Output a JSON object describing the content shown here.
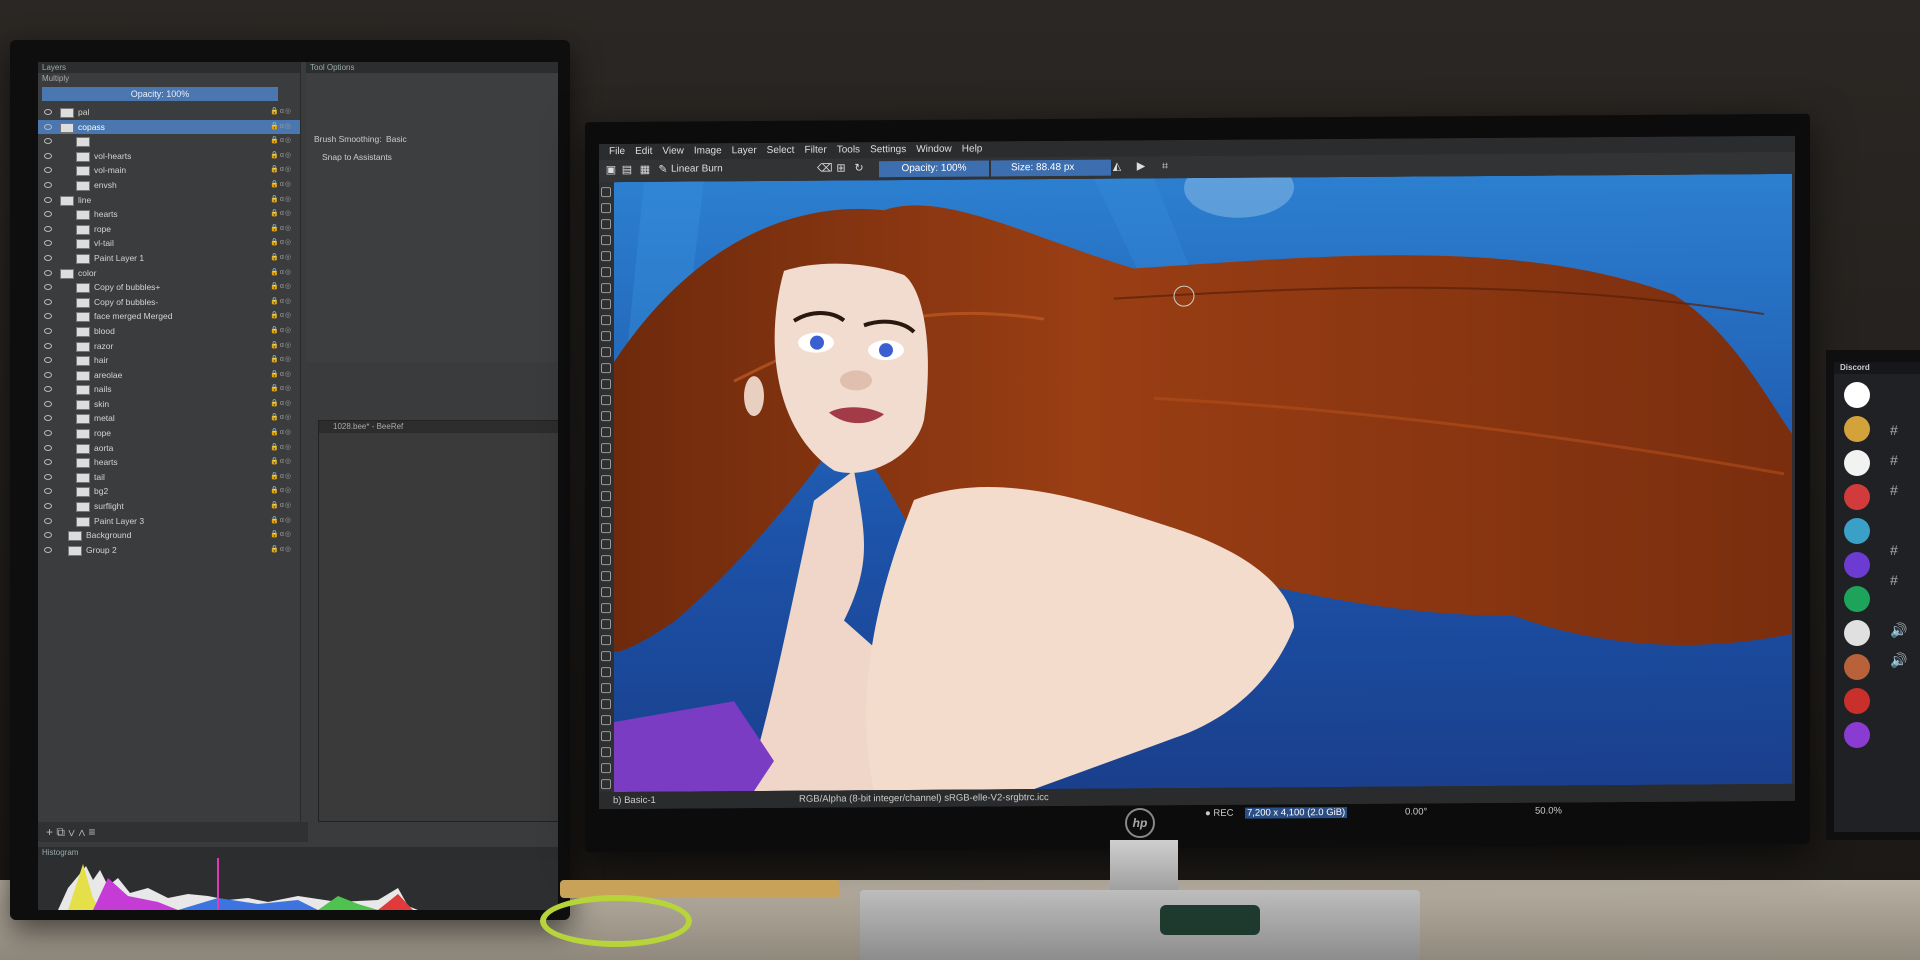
{
  "left_screen": {
    "layers_title": "Layers",
    "blend_mode": "Multiply",
    "opacity_label": "Opacity: 100%",
    "tool_options_title": "Tool Options",
    "brush_smoothing_label": "Brush Smoothing:",
    "brush_smoothing_value": "Basic",
    "snap_to_assistants": "Snap to Assistants",
    "beeref_title": "1028.bee* - BeeRef",
    "histogram_title": "Histogram",
    "layers": [
      {
        "name": "pal",
        "indent": 0,
        "selected": false
      },
      {
        "name": "copass",
        "indent": 0,
        "selected": true
      },
      {
        "name": "",
        "indent": 2,
        "selected": false
      },
      {
        "name": "vol-hearts",
        "indent": 2,
        "selected": false
      },
      {
        "name": "vol-main",
        "indent": 2,
        "selected": false
      },
      {
        "name": "envsh",
        "indent": 2,
        "selected": false
      },
      {
        "name": "line",
        "indent": 0,
        "selected": false
      },
      {
        "name": "hearts",
        "indent": 2,
        "selected": false
      },
      {
        "name": "rope",
        "indent": 2,
        "selected": false
      },
      {
        "name": "vl-tail",
        "indent": 2,
        "selected": false
      },
      {
        "name": "Paint Layer 1",
        "indent": 2,
        "selected": false
      },
      {
        "name": "color",
        "indent": 0,
        "selected": false
      },
      {
        "name": "Copy of bubbles+",
        "indent": 2,
        "selected": false
      },
      {
        "name": "Copy of bubbles-",
        "indent": 2,
        "selected": false
      },
      {
        "name": "face merged Merged",
        "indent": 2,
        "selected": false
      },
      {
        "name": "blood",
        "indent": 2,
        "selected": false
      },
      {
        "name": "razor",
        "indent": 2,
        "selected": false
      },
      {
        "name": "hair",
        "indent": 2,
        "selected": false
      },
      {
        "name": "areolae",
        "indent": 2,
        "selected": false
      },
      {
        "name": "nails",
        "indent": 2,
        "selected": false
      },
      {
        "name": "skin",
        "indent": 2,
        "selected": false
      },
      {
        "name": "metal",
        "indent": 2,
        "selected": false
      },
      {
        "name": "rope",
        "indent": 2,
        "selected": false
      },
      {
        "name": "aorta",
        "indent": 2,
        "selected": false
      },
      {
        "name": "hearts",
        "indent": 2,
        "selected": false
      },
      {
        "name": "tail",
        "indent": 2,
        "selected": false
      },
      {
        "name": "bg2",
        "indent": 2,
        "selected": false
      },
      {
        "name": "surflight",
        "indent": 2,
        "selected": false
      },
      {
        "name": "Paint Layer 3",
        "indent": 2,
        "selected": false
      },
      {
        "name": "Background",
        "indent": 1,
        "selected": false
      },
      {
        "name": "Group 2",
        "indent": 1,
        "selected": false
      }
    ]
  },
  "main_screen": {
    "menu": [
      "File",
      "Edit",
      "View",
      "Image",
      "Layer",
      "Select",
      "Filter",
      "Tools",
      "Settings",
      "Window",
      "Help"
    ],
    "blend_mode": "Linear Burn",
    "opacity": "Opacity: 100%",
    "size_label": "Size:",
    "size_value": "88.48 px",
    "document_tab": "b) Basic-1",
    "color_space": "RGB/Alpha (8-bit integer/channel)  sRGB-elle-V2-srgbtrc.icc",
    "rec": "● REC",
    "dimensions": "7,200 x 4,100 (2.0 GiB)",
    "rotation": "0.00°",
    "zoom": "50.0%",
    "brand": "hp"
  },
  "discord": {
    "title": "Discord",
    "guild_colors": [
      "#ffffff",
      "#d4a23a",
      "#f2f2f2",
      "#d23b3b",
      "#3aa0c8",
      "#6c3bd1",
      "#1ea35a",
      "#e0e0e0",
      "#b8613a",
      "#c9302c",
      "#8a3bd1"
    ]
  },
  "colors": {
    "accent": "#4a77b0",
    "hair": "#8b3510",
    "water": "#1f5fb0"
  }
}
